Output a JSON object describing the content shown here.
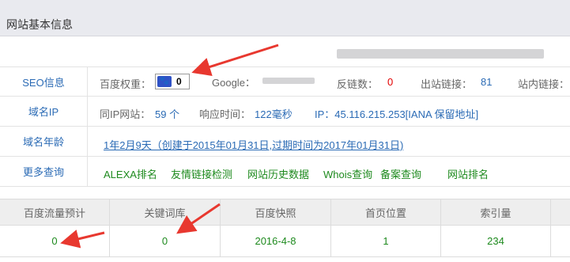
{
  "header": {
    "title": "网站基本信息"
  },
  "seo": {
    "label": "SEO信息",
    "baidu_weight_label": "百度权重：",
    "baidu_weight_value": "0",
    "google_label": "Google：",
    "backlinks_label": "反链数：",
    "backlinks_value": "0",
    "outlinks_label": "出站链接：",
    "outlinks_value": "81",
    "inlinks_label": "站内链接："
  },
  "domain_ip": {
    "label": "域名IP",
    "same_ip_label": "同IP网站：",
    "same_ip_value": "59 个",
    "response_label": "响应时间：",
    "response_value": "122毫秒",
    "ip_text": "IP：45.116.215.253[IANA 保留地址]"
  },
  "domain_age": {
    "label": "域名年龄",
    "text": "1年2月9天（创建于2015年01月31日,过期时间为2017年01月31日)"
  },
  "more": {
    "label": "更多查询",
    "links": [
      "ALEXA排名",
      "友情链接检测",
      "网站历史数据",
      "Whois查询",
      "备案查询",
      "网站排名"
    ]
  },
  "stats": {
    "headers": [
      "百度流量预计",
      "关键词库",
      "百度快照",
      "首页位置",
      "索引量"
    ],
    "values": [
      "0",
      "0",
      "2016-4-8",
      "1",
      "234"
    ]
  },
  "colors": {
    "label_blue": "#2b6bb5",
    "value_green": "#1e8a1e",
    "value_red": "#e30000",
    "annotation_arrow": "#e8382f"
  }
}
